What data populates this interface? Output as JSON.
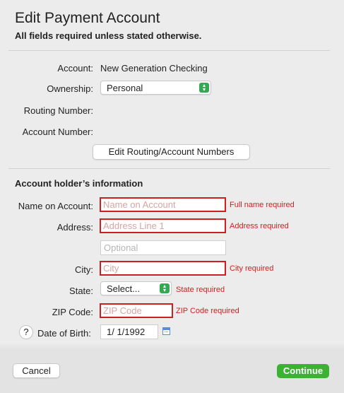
{
  "dialog": {
    "title": "Edit Payment Account",
    "subtitle": "All fields required unless stated otherwise."
  },
  "account": {
    "account_label": "Account:",
    "account_value": "New Generation Checking",
    "ownership_label": "Ownership:",
    "ownership_value": "Personal",
    "routing_label": "Routing Number:",
    "account_number_label": "Account Number:",
    "edit_button": "Edit Routing/Account Numbers"
  },
  "holder": {
    "section_title": "Account holder’s information",
    "name_label": "Name on Account:",
    "name_placeholder": "Name on Account",
    "name_error": "Full name required",
    "address_label": "Address:",
    "address1_placeholder": "Address Line 1",
    "address_error": "Address required",
    "address2_placeholder": "Optional",
    "city_label": "City:",
    "city_placeholder": "City",
    "city_error": "City required",
    "state_label": "State:",
    "state_value": "Select...",
    "state_error": "State required",
    "zip_label": "ZIP Code:",
    "zip_placeholder": "ZIP Code",
    "zip_error": "ZIP Code required",
    "help_glyph": "?",
    "dob_label": "Date of Birth:",
    "dob_value": "1/  1/1992",
    "calendar_icon": "calendar-icon"
  },
  "footer": {
    "cancel_label": "Cancel",
    "continue_label": "Continue"
  },
  "colors": {
    "error_red": "#d11f1f",
    "continue_green": "#3cb233",
    "stepper_green": "#34a853"
  }
}
